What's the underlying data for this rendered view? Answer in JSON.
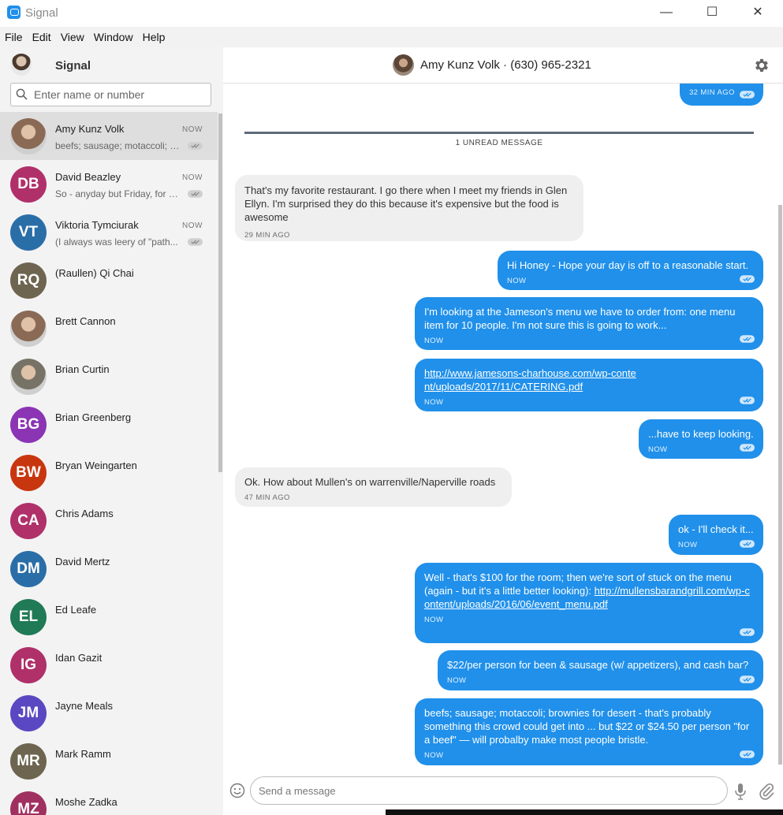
{
  "window": {
    "title": "Signal",
    "icon": "signal-app-icon",
    "controls": {
      "minimize": "—",
      "maximize": "☐",
      "close": "✕"
    }
  },
  "menu": [
    "File",
    "Edit",
    "View",
    "Window",
    "Help"
  ],
  "left": {
    "title": "Signal",
    "search_placeholder": "Enter name or number",
    "conversations": [
      {
        "name": "Amy Kunz Volk",
        "time": "NOW",
        "preview": "beefs; sausage; motaccoli; brownies for desert - that's probably something this crowd could get into",
        "avatar": "photo",
        "color": "#8a6a55",
        "active": true
      },
      {
        "name": "David Beazley",
        "time": "NOW",
        "preview": "So - anyday but Friday, for me",
        "initials": "DB",
        "color": "#b0306a"
      },
      {
        "name": "Viktoria Tymciurak",
        "time": "NOW",
        "preview": "(I always was leery of \"path...",
        "initials": "VT",
        "color": "#2a6ea8"
      },
      {
        "name": "(Raullen) Qi Chai",
        "initials": "RQ",
        "color": "#6e6550"
      },
      {
        "name": "Brett Cannon",
        "avatar": "photo",
        "color": "#8a6a55"
      },
      {
        "name": "Brian Curtin",
        "avatar": "photo",
        "color": "#777266"
      },
      {
        "name": "Brian Greenberg",
        "initials": "BG",
        "color": "#8b35b5"
      },
      {
        "name": "Bryan Weingarten",
        "initials": "BW",
        "color": "#c8360f"
      },
      {
        "name": "Chris Adams",
        "initials": "CA",
        "color": "#b0306a"
      },
      {
        "name": "David Mertz",
        "initials": "DM",
        "color": "#2a6ea8"
      },
      {
        "name": "Ed Leafe",
        "initials": "EL",
        "color": "#1f7a55"
      },
      {
        "name": "Idan Gazit",
        "initials": "IG",
        "color": "#b0306a"
      },
      {
        "name": "Jayne Meals",
        "initials": "JM",
        "color": "#5a48c2"
      },
      {
        "name": "Mark Ramm",
        "initials": "MR",
        "color": "#6e6550"
      },
      {
        "name": "Moshe Zadka",
        "initials": "MZ",
        "color": "#a03060"
      }
    ]
  },
  "conversation": {
    "title": "Amy Kunz Volk · (630) 965-2321",
    "unread_label": "1 UNREAD MESSAGE",
    "partial_top_time": "32 MIN AGO",
    "messages": [
      {
        "dir": "in",
        "text": "That's my favorite restaurant. I go there when I meet my friends in Glen Ellyn. I'm surprised they do this because it's expensive but the food is awesome",
        "time": "29 MIN AGO"
      },
      {
        "dir": "out",
        "text": "Hi Honey -  Hope your day is off to a reasonable start.",
        "time": "NOW"
      },
      {
        "dir": "out",
        "text": "I'm looking at the Jameson's menu we have to order from:  one menu item for 10 people.   I'm not sure this is going to work...",
        "time": "NOW"
      },
      {
        "dir": "out",
        "link": "http://www.jamesons-charhouse.com/wp-content/uploads/2017/11/CATERING.pdf",
        "time": "NOW"
      },
      {
        "dir": "out",
        "text": "...have to keep looking.",
        "time": "NOW"
      },
      {
        "dir": "in",
        "text": "Ok.  How about Mullen's on warrenville/Naperville roads",
        "time": "47 MIN AGO"
      },
      {
        "dir": "out",
        "text": "ok - I'll check it...",
        "time": "NOW"
      },
      {
        "dir": "out",
        "text": "Well - that's $100 for the room; then we're sort of stuck on the menu (again - but it's a little better looking):",
        "link": "http://mullensbarandgrill.com/wp-content/uploads/2016/06/event_menu.pdf",
        "time": "NOW"
      },
      {
        "dir": "out",
        "text": "$22/per person for been & sausage (w/ appetizers), and cash bar?",
        "time": "NOW"
      },
      {
        "dir": "out",
        "text": "beefs; sausage; motaccoli; brownies for desert - that's probably something this crowd could get into ... but $22 or $24.50 per person \"for a beef\" — will probalby make most people bristle.",
        "time": "NOW"
      }
    ]
  },
  "composer": {
    "placeholder": "Send a message"
  },
  "colors": {
    "accent": "#2090ea",
    "incoming": "#efefef",
    "sidebar": "#f3f3f3"
  }
}
